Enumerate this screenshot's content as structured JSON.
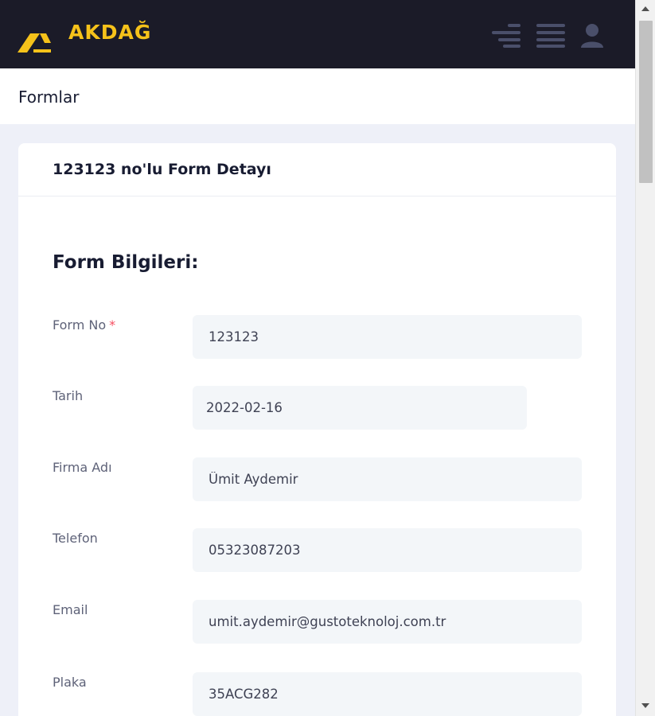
{
  "header": {
    "brand": "AKDAĞ",
    "icons": [
      "menu-toggle-icon",
      "hamburger-icon",
      "user-icon"
    ],
    "brand_color": "#f6c21a",
    "bg_color": "#1b1b28"
  },
  "subheader": {
    "title": "Formlar"
  },
  "card": {
    "title": "123123 no'lu Form Detayı",
    "section_title": "Form Bilgileri:",
    "fields": {
      "form_no": {
        "label": "Form No",
        "required_mark": "*",
        "value": "123123"
      },
      "tarih": {
        "label": "Tarih",
        "value": "2022-02-16"
      },
      "firma_adi": {
        "label": "Firma Adı",
        "value": "Ümit Aydemir"
      },
      "telefon": {
        "label": "Telefon",
        "value": "05323087203"
      },
      "email": {
        "label": "Email",
        "value": "umit.aydemir@gustoteknoloj.com.tr"
      },
      "plaka": {
        "label": "Plaka",
        "value": "35ACG282"
      }
    }
  }
}
